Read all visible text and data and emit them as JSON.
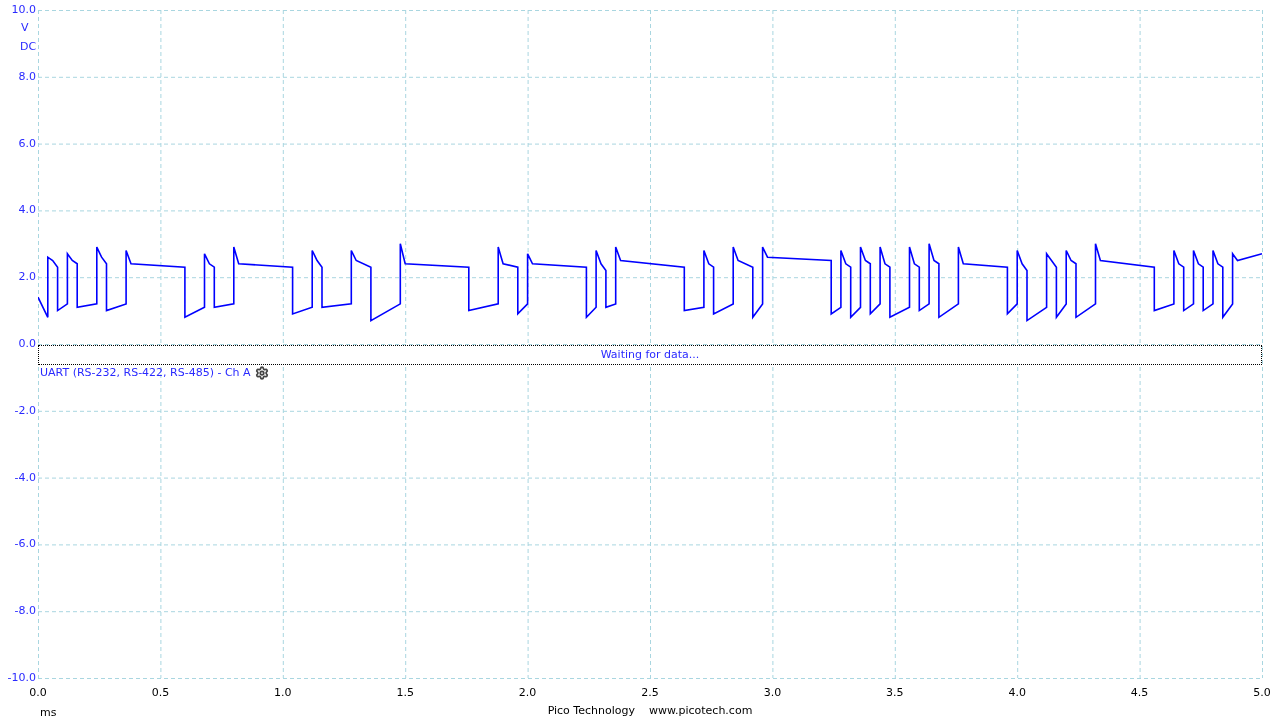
{
  "chart_data": {
    "type": "line",
    "grid": true,
    "xlabel": "ms",
    "ylabel": "V",
    "xlim": [
      0,
      5
    ],
    "ylim": [
      -10,
      10
    ],
    "xticks": [
      {
        "value": 0,
        "label": "0.0"
      },
      {
        "value": 0.5,
        "label": "0.5"
      },
      {
        "value": 1,
        "label": "1.0"
      },
      {
        "value": 1.5,
        "label": "1.5"
      },
      {
        "value": 2,
        "label": "2.0"
      },
      {
        "value": 2.5,
        "label": "2.5"
      },
      {
        "value": 3,
        "label": "3.0"
      },
      {
        "value": 3.5,
        "label": "3.5"
      },
      {
        "value": 4,
        "label": "4.0"
      },
      {
        "value": 4.5,
        "label": "4.5"
      },
      {
        "value": 5,
        "label": "5.0"
      }
    ],
    "yticks": [
      {
        "value": 10,
        "label": "10.0"
      },
      {
        "value": 8,
        "label": "8.0"
      },
      {
        "value": 6,
        "label": "6.0"
      },
      {
        "value": 4,
        "label": "4.0"
      },
      {
        "value": 2,
        "label": "2.0"
      },
      {
        "value": 0,
        "label": "0.0"
      },
      {
        "value": -2,
        "label": "-2.0"
      },
      {
        "value": -4,
        "label": "-4.0"
      },
      {
        "value": -6,
        "label": "-6.0"
      },
      {
        "value": -8,
        "label": "-8.0"
      },
      {
        "value": -10,
        "label": "-10.0"
      }
    ],
    "x": [
      0,
      0.04,
      0.04,
      0.06,
      0.08,
      0.08,
      0.12,
      0.12,
      0.14,
      0.16,
      0.16,
      0.24,
      0.24,
      0.26,
      0.28,
      0.28,
      0.36,
      0.36,
      0.38,
      0.6,
      0.6,
      0.68,
      0.68,
      0.7,
      0.72,
      0.72,
      0.8,
      0.8,
      0.82,
      1.04,
      1.04,
      1.12,
      1.12,
      1.14,
      1.16,
      1.16,
      1.28,
      1.28,
      1.3,
      1.36,
      1.36,
      1.48,
      1.48,
      1.5,
      1.76,
      1.76,
      1.88,
      1.88,
      1.9,
      1.96,
      1.96,
      2.0,
      2.0,
      2.02,
      2.24,
      2.24,
      2.28,
      2.28,
      2.3,
      2.32,
      2.32,
      2.36,
      2.36,
      2.38,
      2.64,
      2.64,
      2.72,
      2.72,
      2.74,
      2.76,
      2.76,
      2.84,
      2.84,
      2.86,
      2.92,
      2.92,
      2.96,
      2.96,
      2.98,
      3.24,
      3.24,
      3.28,
      3.28,
      3.3,
      3.32,
      3.32,
      3.36,
      3.36,
      3.38,
      3.4,
      3.4,
      3.44,
      3.44,
      3.46,
      3.48,
      3.48,
      3.56,
      3.56,
      3.58,
      3.6,
      3.6,
      3.64,
      3.64,
      3.66,
      3.68,
      3.68,
      3.76,
      3.76,
      3.78,
      3.96,
      3.96,
      4.0,
      4.0,
      4.02,
      4.04,
      4.04,
      4.12,
      4.12,
      4.14,
      4.16,
      4.16,
      4.2,
      4.2,
      4.22,
      4.24,
      4.24,
      4.32,
      4.32,
      4.34,
      4.56,
      4.56,
      4.64,
      4.64,
      4.66,
      4.68,
      4.68,
      4.72,
      4.72,
      4.74,
      4.76,
      4.76,
      4.8,
      4.8,
      4.82,
      4.84,
      4.84,
      4.88,
      4.88,
      4.9,
      5.0
    ],
    "series": [
      {
        "color": "#0000ff",
        "values": [
          1.4,
          0.8,
          2.6,
          2.5,
          2.3,
          1.0,
          1.2,
          2.7,
          2.5,
          2.4,
          1.1,
          1.2,
          2.9,
          2.6,
          2.4,
          1.0,
          1.2,
          2.8,
          2.4,
          2.3,
          0.8,
          1.1,
          2.7,
          2.4,
          2.3,
          1.1,
          1.2,
          2.9,
          2.4,
          2.3,
          0.9,
          1.1,
          2.8,
          2.5,
          2.3,
          1.1,
          1.2,
          2.8,
          2.5,
          2.3,
          0.7,
          1.2,
          3.0,
          2.4,
          2.3,
          1.0,
          1.2,
          2.9,
          2.4,
          2.3,
          0.9,
          1.2,
          2.7,
          2.4,
          2.3,
          0.8,
          1.1,
          2.8,
          2.4,
          2.2,
          1.1,
          1.2,
          2.9,
          2.5,
          2.3,
          1.0,
          1.1,
          2.8,
          2.4,
          2.3,
          0.9,
          1.2,
          2.9,
          2.5,
          2.3,
          0.8,
          1.2,
          2.9,
          2.6,
          2.5,
          0.9,
          1.1,
          2.8,
          2.4,
          2.3,
          0.8,
          1.1,
          2.9,
          2.5,
          2.4,
          0.9,
          1.2,
          2.9,
          2.4,
          2.3,
          0.8,
          1.1,
          2.9,
          2.4,
          2.3,
          1.0,
          1.2,
          3.0,
          2.5,
          2.4,
          0.8,
          1.2,
          2.9,
          2.4,
          2.3,
          0.9,
          1.2,
          2.8,
          2.4,
          2.2,
          0.7,
          1.1,
          2.7,
          2.5,
          2.3,
          0.8,
          1.2,
          2.8,
          2.5,
          2.4,
          0.8,
          1.2,
          3.0,
          2.5,
          2.3,
          1.0,
          1.2,
          2.8,
          2.4,
          2.3,
          1.0,
          1.2,
          2.8,
          2.4,
          2.3,
          1.0,
          1.2,
          2.8,
          2.4,
          2.3,
          0.8,
          1.2,
          2.7,
          2.5,
          2.7
        ]
      }
    ]
  },
  "coupling": "DC",
  "decoder": {
    "status": "Waiting for data...",
    "label": "UART (RS-232, RS-422, RS-485) - Ch A"
  },
  "footer": {
    "company": "Pico Technology",
    "website": "www.picotech.com"
  }
}
